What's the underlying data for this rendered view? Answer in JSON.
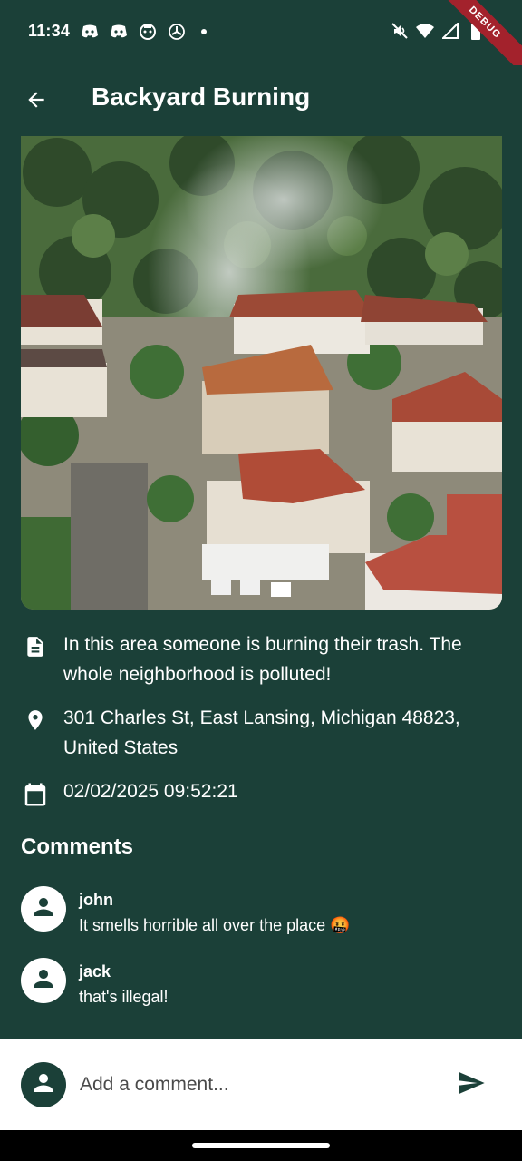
{
  "status_bar": {
    "time": "11:34",
    "debug_label": "DEBUG",
    "left_icons": [
      "discord-icon",
      "discord-icon",
      "bot-icon",
      "fan-icon",
      "dot-icon"
    ],
    "right_icons": [
      "mute-icon",
      "wifi-icon",
      "signal-icon",
      "battery-icon"
    ]
  },
  "app_bar": {
    "title": "Backyard Burning",
    "back_icon": "arrow-back-icon"
  },
  "report": {
    "photo": "aerial photo of residential neighborhood with smoke rising from a backyard",
    "description": "In this area someone is burning their trash. The whole neighborhood is polluted!",
    "address": "301 Charles St, East Lansing, Michigan 48823, United States",
    "datetime": "02/02/2025 09:52:21"
  },
  "comments": {
    "heading": "Comments",
    "items": [
      {
        "author": "john",
        "text": "It smells horrible all over the place 🤬"
      },
      {
        "author": "jack",
        "text": "that's illegal!"
      }
    ]
  },
  "composer": {
    "placeholder": "Add a comment...",
    "send_icon": "send-icon"
  },
  "colors": {
    "background": "#1b4038",
    "text": "#ffffff",
    "composer_bg": "#ffffff"
  }
}
